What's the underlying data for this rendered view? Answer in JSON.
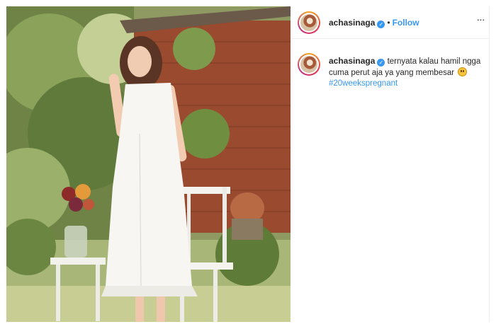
{
  "post": {
    "author": {
      "username": "achasinaga",
      "verified": true,
      "avatar_icon": "profile-avatar"
    },
    "header": {
      "separator": "•",
      "follow_label": "Follow",
      "more_icon": "more-horizontal-icon",
      "more_glyph": "···"
    },
    "caption": {
      "username": "achasinaga",
      "text": "ternyata kalau hamil ngga cuma perut aja ya yang membesar",
      "emoji": "grinning-sweat-face",
      "hashtag": "#20weekspregnant"
    },
    "image": {
      "description_icon": "post-photo"
    }
  },
  "colors": {
    "link": "#3897f0",
    "text": "#262626",
    "border": "#efefef",
    "verified": "#3897f0"
  }
}
